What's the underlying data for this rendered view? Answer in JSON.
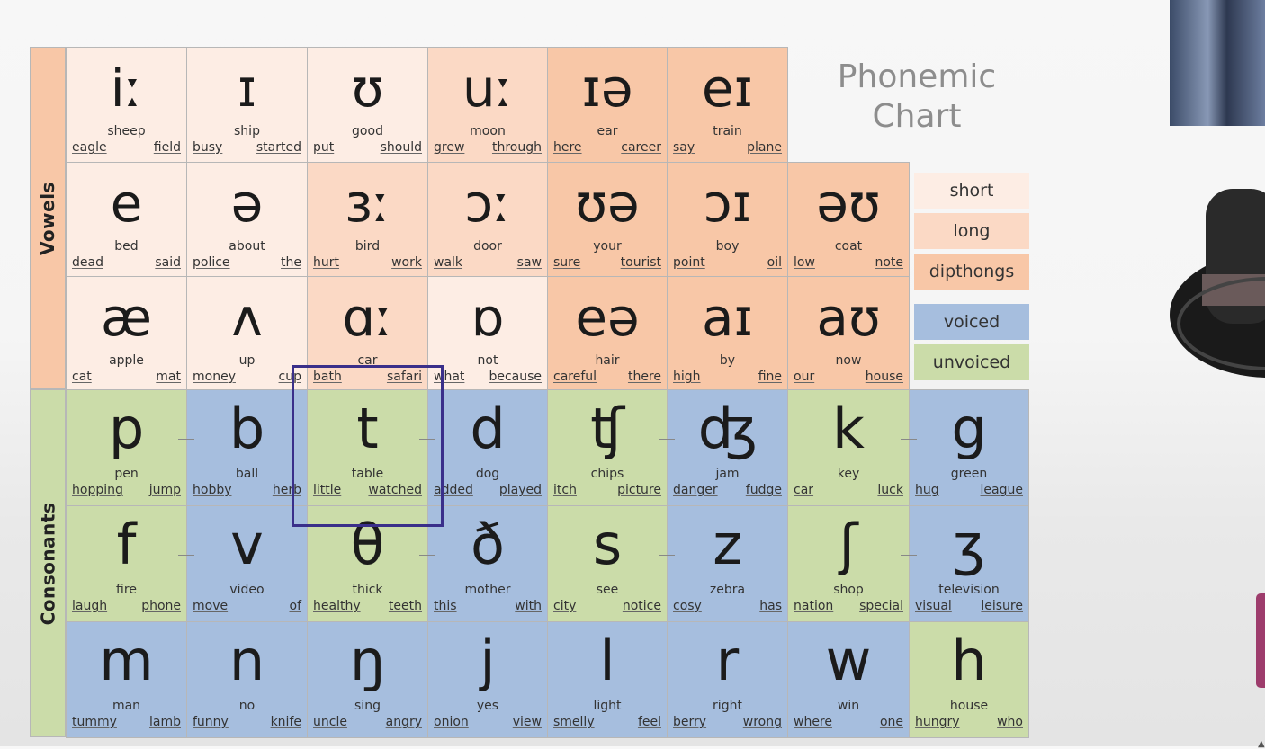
{
  "chart": {
    "title_line1": "Phonemic",
    "title_line2": "Chart",
    "side_labels": {
      "vowels": "Vowels",
      "consonants": "Consonants"
    },
    "legend": [
      "short",
      "long",
      "dipthongs",
      "voiced",
      "unvoiced"
    ],
    "vowels": [
      [
        {
          "sym": "iː",
          "key": "sheep",
          "ex": [
            "eagle",
            "field"
          ]
        },
        {
          "sym": "ɪ",
          "key": "ship",
          "ex": [
            "busy",
            "started"
          ]
        },
        {
          "sym": "ʊ",
          "key": "good",
          "ex": [
            "put",
            "should"
          ]
        },
        {
          "sym": "uː",
          "key": "moon",
          "ex": [
            "grew",
            "through"
          ]
        },
        {
          "sym": "ɪə",
          "key": "ear",
          "ex": [
            "here",
            "career"
          ]
        },
        {
          "sym": "eɪ",
          "key": "train",
          "ex": [
            "say",
            "plane"
          ]
        }
      ],
      [
        {
          "sym": "e",
          "key": "bed",
          "ex": [
            "dead",
            "said"
          ]
        },
        {
          "sym": "ə",
          "key": "about",
          "ex": [
            "police",
            "the"
          ]
        },
        {
          "sym": "ɜː",
          "key": "bird",
          "ex": [
            "hurt",
            "work"
          ]
        },
        {
          "sym": "ɔː",
          "key": "door",
          "ex": [
            "walk",
            "saw"
          ]
        },
        {
          "sym": "ʊə",
          "key": "your",
          "ex": [
            "sure",
            "tourist"
          ]
        },
        {
          "sym": "ɔɪ",
          "key": "boy",
          "ex": [
            "point",
            "oil"
          ]
        },
        {
          "sym": "əʊ",
          "key": "coat",
          "ex": [
            "low",
            "note"
          ]
        }
      ],
      [
        {
          "sym": "æ",
          "key": "apple",
          "ex": [
            "cat",
            "mat"
          ]
        },
        {
          "sym": "ʌ",
          "key": "up",
          "ex": [
            "money",
            "cup"
          ]
        },
        {
          "sym": "ɑː",
          "key": "car",
          "ex": [
            "bath",
            "safari"
          ]
        },
        {
          "sym": "ɒ",
          "key": "not",
          "ex": [
            "what",
            "because"
          ]
        },
        {
          "sym": "eə",
          "key": "hair",
          "ex": [
            "careful",
            "there"
          ]
        },
        {
          "sym": "aɪ",
          "key": "by",
          "ex": [
            "high",
            "fine"
          ]
        },
        {
          "sym": "aʊ",
          "key": "now",
          "ex": [
            "our",
            "house"
          ]
        }
      ]
    ],
    "consonants": [
      [
        {
          "sym": "p",
          "key": "pen",
          "ex": [
            "hopping",
            "jump"
          ]
        },
        {
          "sym": "b",
          "key": "ball",
          "ex": [
            "hobby",
            "herb"
          ]
        },
        {
          "sym": "t",
          "key": "table",
          "ex": [
            "little",
            "watched"
          ]
        },
        {
          "sym": "d",
          "key": "dog",
          "ex": [
            "added",
            "played"
          ]
        },
        {
          "sym": "ʧ",
          "key": "chips",
          "ex": [
            "itch",
            "picture"
          ]
        },
        {
          "sym": "ʤ",
          "key": "jam",
          "ex": [
            "danger",
            "fudge"
          ]
        },
        {
          "sym": "k",
          "key": "key",
          "ex": [
            "car",
            "luck"
          ]
        },
        {
          "sym": "g",
          "key": "green",
          "ex": [
            "hug",
            "league"
          ]
        }
      ],
      [
        {
          "sym": "f",
          "key": "fire",
          "ex": [
            "laugh",
            "phone"
          ]
        },
        {
          "sym": "v",
          "key": "video",
          "ex": [
            "move",
            "of"
          ]
        },
        {
          "sym": "θ",
          "key": "thick",
          "ex": [
            "healthy",
            "teeth"
          ]
        },
        {
          "sym": "ð",
          "key": "mother",
          "ex": [
            "this",
            "with"
          ]
        },
        {
          "sym": "s",
          "key": "see",
          "ex": [
            "city",
            "notice"
          ]
        },
        {
          "sym": "z",
          "key": "zebra",
          "ex": [
            "cosy",
            "has"
          ]
        },
        {
          "sym": "ʃ",
          "key": "shop",
          "ex": [
            "nation",
            "special"
          ]
        },
        {
          "sym": "ʒ",
          "key": "television",
          "ex": [
            "visual",
            "leisure"
          ]
        }
      ],
      [
        {
          "sym": "m",
          "key": "man",
          "ex": [
            "tummy",
            "lamb"
          ]
        },
        {
          "sym": "n",
          "key": "no",
          "ex": [
            "funny",
            "knife"
          ]
        },
        {
          "sym": "ŋ",
          "key": "sing",
          "ex": [
            "uncle",
            "angry"
          ]
        },
        {
          "sym": "j",
          "key": "yes",
          "ex": [
            "onion",
            "view"
          ]
        },
        {
          "sym": "l",
          "key": "light",
          "ex": [
            "smelly",
            "feel"
          ]
        },
        {
          "sym": "r",
          "key": "right",
          "ex": [
            "berry",
            "wrong"
          ]
        },
        {
          "sym": "w",
          "key": "win",
          "ex": [
            "where",
            "one"
          ]
        },
        {
          "sym": "h",
          "key": "house",
          "ex": [
            "hungry",
            "who"
          ]
        }
      ]
    ],
    "colors": {
      "short": "#fdede4",
      "long": "#fbd9c5",
      "dipthongs": "#f8c7a7",
      "voiced": "#a6bede",
      "unvoiced": "#cbdca9",
      "highlight": "#3a2f8a"
    }
  }
}
